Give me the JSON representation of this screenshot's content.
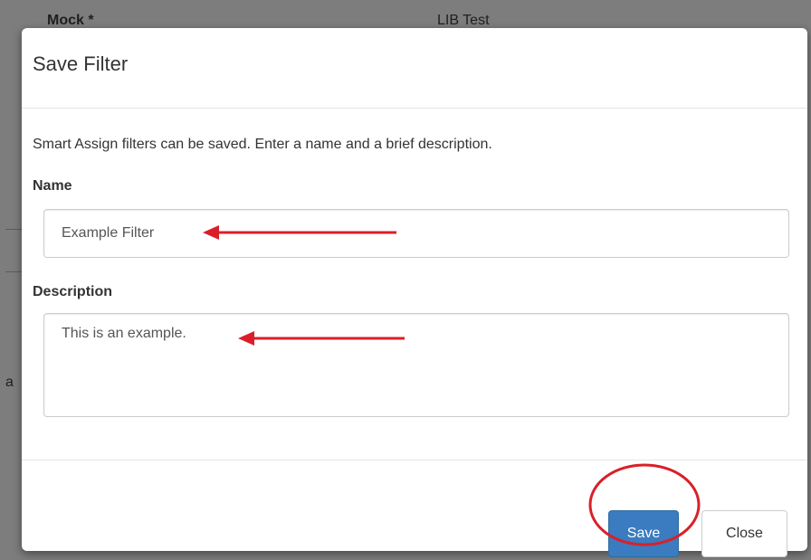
{
  "background": {
    "col1_header": "Mock *",
    "col2_header": "LIB Test",
    "fragment": "a"
  },
  "modal": {
    "title": "Save Filter",
    "description": "Smart Assign filters can be saved. Enter a name and a brief description.",
    "name_label": "Name",
    "name_value": "Example Filter",
    "description_label": "Description",
    "description_value": "This is an example.",
    "save_label": "Save",
    "close_label": "Close"
  },
  "colors": {
    "primary_button": "#3b7bbf",
    "annotation": "#d9202a"
  }
}
